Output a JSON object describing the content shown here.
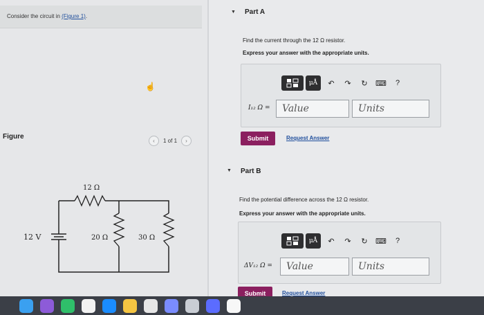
{
  "intro": {
    "text": "Consider the circuit in ",
    "link": "(Figure 1)",
    "suffix": "."
  },
  "figure": {
    "label": "Figure",
    "pager": "1 of 1"
  },
  "circuit": {
    "r12": "12 Ω",
    "r20": "20 Ω",
    "r30": "30 Ω",
    "battery": "12 V"
  },
  "partA": {
    "title": "Part A",
    "prompt": "Find the current through the 12 Ω resistor.",
    "express": "Express your answer with the appropriate units.",
    "toolbar": {
      "unit_button": "μÅ",
      "help": "?"
    },
    "field_label": "I₁₂ Ω =",
    "value_placeholder": "Value",
    "units_placeholder": "Units",
    "submit": "Submit",
    "request": "Request Answer"
  },
  "partB": {
    "title": "Part B",
    "prompt": "Find the potential difference across the 12 Ω resistor.",
    "express": "Express your answer with the appropriate units.",
    "toolbar": {
      "unit_button": "μÅ",
      "help": "?"
    },
    "field_label": "ΔV₁₂ Ω =",
    "value_placeholder": "Value",
    "units_placeholder": "Units",
    "submit": "Submit",
    "request": "Request Answer"
  },
  "colors": {
    "submit": "#8b1f5f",
    "link": "#1f4e9c",
    "toolbar": "#2e2e30"
  }
}
